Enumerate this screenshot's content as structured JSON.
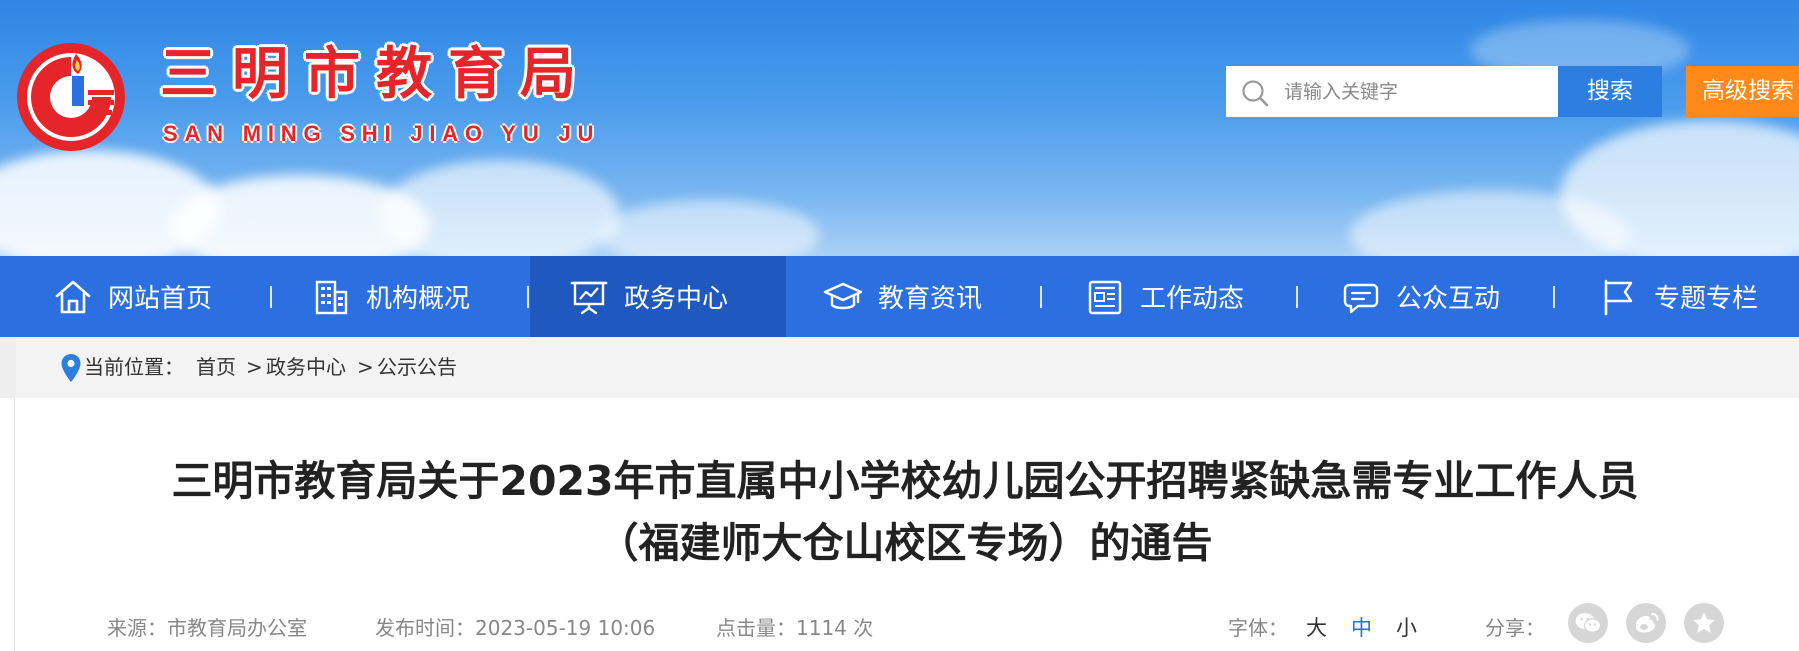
{
  "header": {
    "site_title": "三明市教育局",
    "site_pinyin": "SAN MING SHI JIAO YU JU",
    "search_placeholder": "请输入关键字",
    "search_button": "搜索",
    "advanced_search_button": "高级搜索"
  },
  "nav": {
    "items": [
      {
        "label": "网站首页",
        "icon": "home-icon"
      },
      {
        "label": "机构概况",
        "icon": "building-icon"
      },
      {
        "label": "政务中心",
        "icon": "presentation-board-icon",
        "active": true
      },
      {
        "label": "教育资讯",
        "icon": "graduation-cap-icon"
      },
      {
        "label": "工作动态",
        "icon": "news-document-icon"
      },
      {
        "label": "公众互动",
        "icon": "chat-bubble-icon"
      },
      {
        "label": "专题专栏",
        "icon": "flag-icon"
      }
    ]
  },
  "breadcrumb": {
    "prefix": "当前位置：",
    "items": [
      "首页",
      "政务中心",
      "公示公告"
    ],
    "separator": ">"
  },
  "article": {
    "title_line1": "三明市教育局关于2023年市直属中小学校幼儿园公开招聘紧缺急需专业工作人员",
    "title_line2": "（福建师大仓山校区专场）的通告",
    "source_label": "来源：",
    "source_value": "市教育局办公室",
    "time_label": "发布时间：",
    "time_value": "2023-05-19 10:06",
    "clicks_label": "点击量：",
    "clicks_value": "1114 次",
    "font_label": "字体：",
    "font_sizes": [
      "大",
      "中",
      "小"
    ],
    "share_label": "分享：",
    "share_icons": [
      "wechat-icon",
      "weibo-icon",
      "star-icon"
    ]
  },
  "colors": {
    "brand_red": "#e5252a",
    "nav_blue": "#2c6fe0",
    "nav_active": "#1f58bf",
    "search_blue": "#2c7fe0",
    "advanced_orange": "#ff8a1a",
    "font_active_blue": "#2c6fe0"
  }
}
